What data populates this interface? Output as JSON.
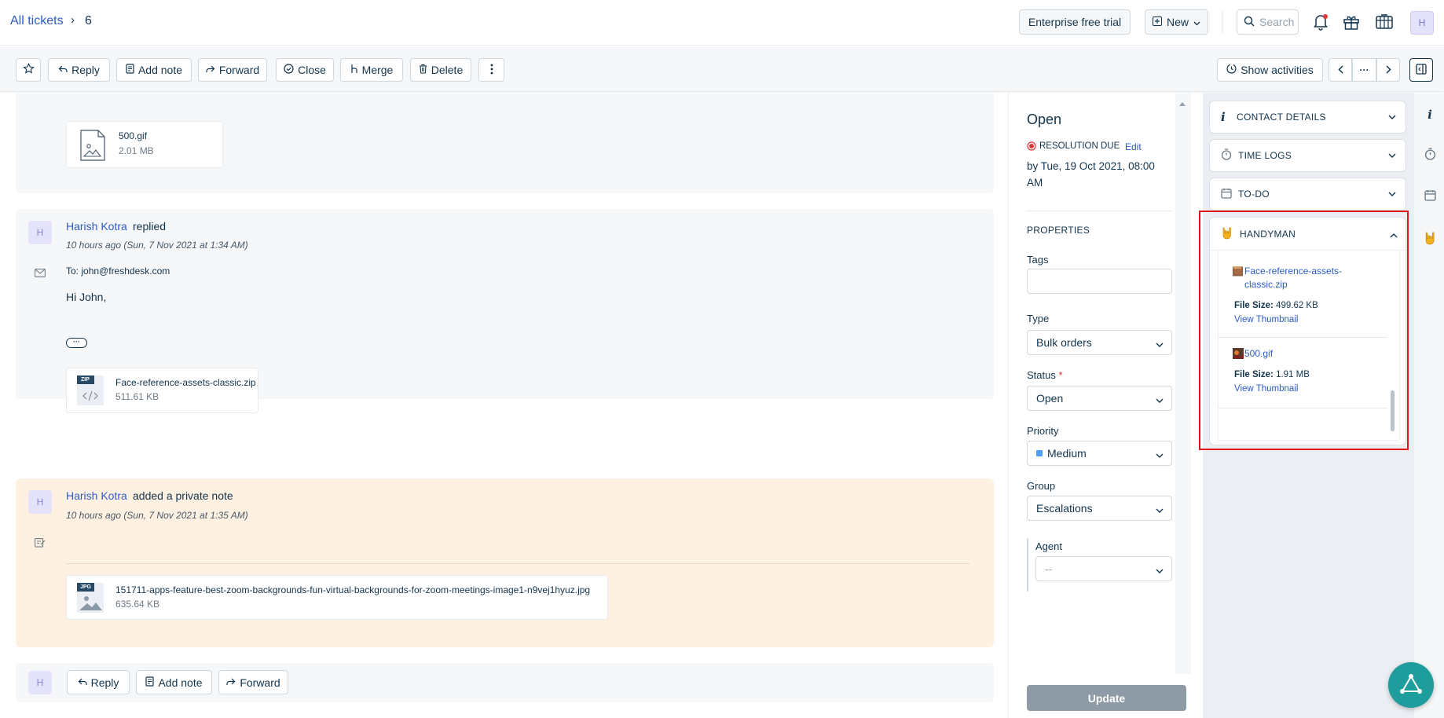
{
  "header": {
    "breadcrumb_link": "All tickets",
    "breadcrumb_sep": "›",
    "ticket_id": "6",
    "trial_label": "Enterprise free trial",
    "new_label": "New",
    "search_placeholder": "Search",
    "avatar_initial": "H"
  },
  "toolbar": {
    "reply": "Reply",
    "add_note": "Add note",
    "forward": "Forward",
    "close": "Close",
    "merge": "Merge",
    "delete": "Delete",
    "show_activities": "Show activities",
    "pager_more": "···"
  },
  "conversation": {
    "first_attachment": {
      "name": "500.gif",
      "size": "2.01 MB"
    },
    "reply": {
      "avatar": "H",
      "author": "Harish Kotra",
      "action": "replied",
      "time": "10 hours ago (Sun, 7 Nov 2021 at 1:34 AM)",
      "to_label": "To:",
      "to_value": "john@freshdesk.com",
      "greeting": "Hi John,",
      "ellipsis": "···",
      "attachment": {
        "badge": "ZIP",
        "name": "Face-reference-assets-classic.zip",
        "size": "511.61 KB"
      }
    },
    "note": {
      "avatar": "H",
      "author": "Harish Kotra",
      "action": "added a private note",
      "time": "10 hours ago (Sun, 7 Nov 2021 at 1:35 AM)",
      "attachment": {
        "badge": "JPG",
        "name": "151711-apps-feature-best-zoom-backgrounds-fun-virtual-backgrounds-for-zoom-meetings-image1-n9vej1hyuz.jpg",
        "size": "635.64 KB"
      }
    },
    "bottom": {
      "avatar": "H",
      "reply": "Reply",
      "add_note": "Add note",
      "forward": "Forward"
    }
  },
  "properties": {
    "status_title": "Open",
    "resolution_label": "RESOLUTION DUE",
    "edit_label": "Edit",
    "due_text": "by Tue, 19 Oct 2021, 08:00 AM",
    "section_title": "PROPERTIES",
    "tags_label": "Tags",
    "tags_value": "",
    "type_label": "Type",
    "type_value": "Bulk orders",
    "status_label": "Status",
    "required_mark": "*",
    "status_value": "Open",
    "priority_label": "Priority",
    "priority_value": "Medium",
    "priority_color": "#4d9ff2",
    "group_label": "Group",
    "group_value": "Escalations",
    "agent_label": "Agent",
    "agent_value": "--",
    "update_button": "Update"
  },
  "apps": {
    "contact_details": "CONTACT DETAILS",
    "time_logs": "TIME LOGS",
    "todo": "TO-DO",
    "handyman": "HANDYMAN",
    "files": [
      {
        "name": "Face-reference-assets-classic.zip",
        "size_label": "File Size:",
        "size": "499.62 KB",
        "thumb": "View Thumbnail"
      },
      {
        "name": "500.gif",
        "size_label": "File Size:",
        "size": "1.91 MB",
        "thumb": "View Thumbnail"
      }
    ]
  },
  "colors": {
    "link": "#2c5cc5",
    "highlight_border": "#e0181b",
    "note_bg": "#fef1e1",
    "update_bg": "#8e9ba6",
    "fab": "#1f9c9c"
  }
}
